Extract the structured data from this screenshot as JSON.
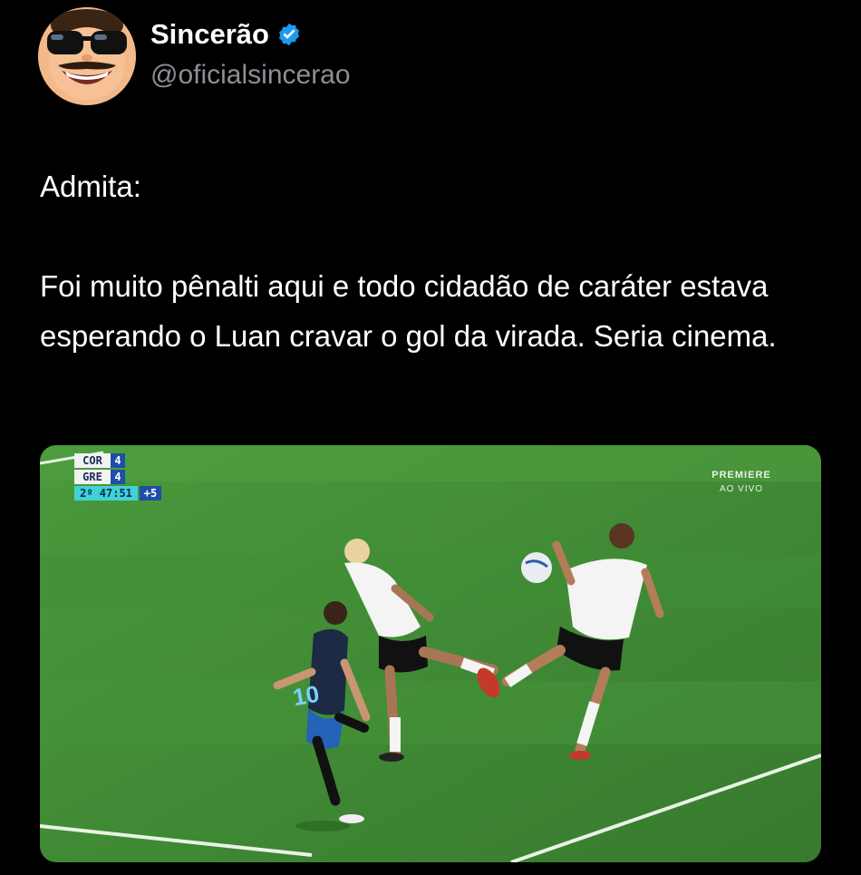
{
  "author": {
    "display_name": "Sincerão",
    "handle": "@oficialsincerao",
    "avatar_icon": "cartoon-sunglasses-face-icon",
    "verified_icon": "verified-badge-icon",
    "verified_color": "#1d9bf0"
  },
  "tweet": {
    "text": "Admita:\n\nFoi muito pênalti aqui e todo cidadão de caráter estava esperando o Luan cravar o gol da virada. Seria cinema."
  },
  "media": {
    "type": "football-match-frame",
    "scoreboard": {
      "home": "COR",
      "home_score": "4",
      "away": "GRE",
      "away_score": "4",
      "clock": "2º 47:51",
      "added_time": "+5"
    },
    "broadcaster": {
      "line1": "PREMIERE",
      "line2": "AO VIVO"
    },
    "pitch_color": "#3f8a34",
    "home_kit_color": "#f4f4f4",
    "away_kit_color": "#1c2a44",
    "player_number": "10"
  }
}
